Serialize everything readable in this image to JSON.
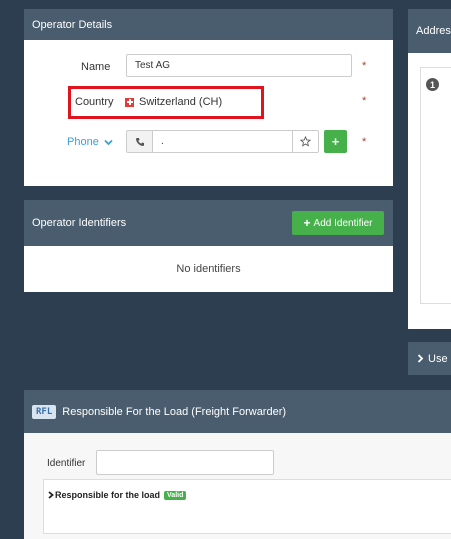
{
  "operator_details": {
    "title": "Operator Details",
    "name_label": "Name",
    "name_value": "Test AG",
    "required_mark": "*",
    "country_label": "Country",
    "country_value": "Switzerland (CH)",
    "phone_label": "Phone",
    "phone_value": ".",
    "phone_add_symbol": "+"
  },
  "operator_identifiers": {
    "title": "Operator Identifiers",
    "add_button": "Add Identifier",
    "empty_text": "No identifiers"
  },
  "address_panel": {
    "title": "Addres",
    "badge": "1"
  },
  "users_bar": {
    "label": "Use"
  },
  "rfl": {
    "badge": "RFL",
    "title": "Responsible For the Load (Freight Forwarder)",
    "identifier_label": "Identifier",
    "identifier_value": "",
    "tree_label": "Responsible for the load",
    "status": "Valid"
  },
  "colors": {
    "background": "#2c3e4f",
    "panel_header": "#4a5d6e",
    "accent_green": "#46b04b",
    "highlight_red": "#e0141e",
    "link_blue": "#3aa0d8"
  }
}
